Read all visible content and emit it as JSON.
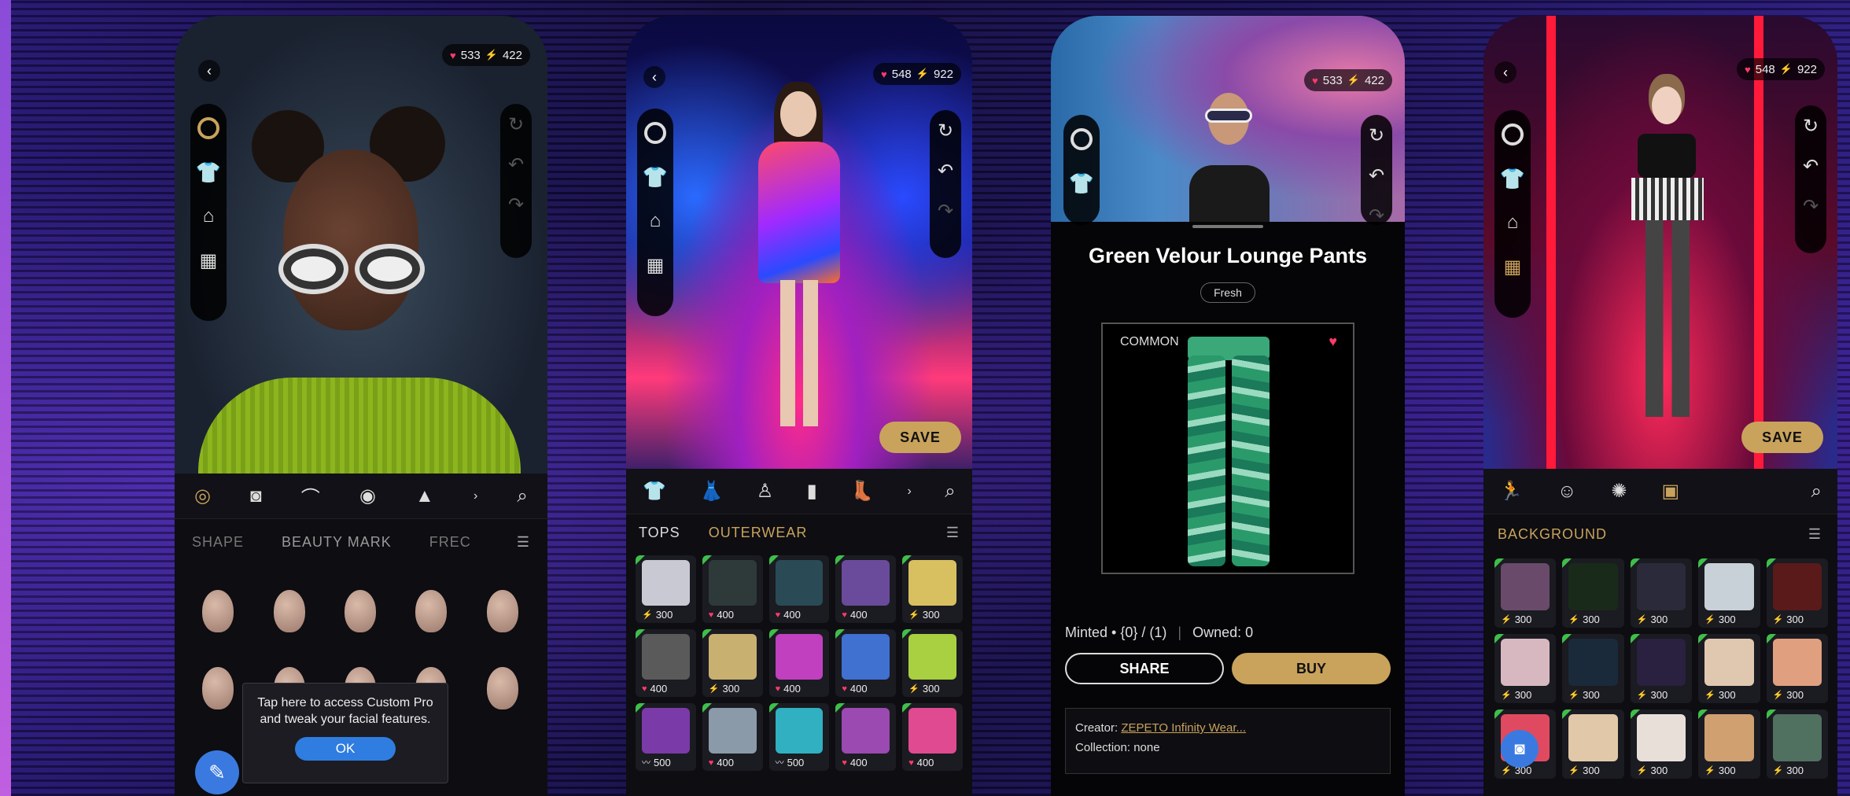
{
  "screens": [
    {
      "stats": {
        "hearts": "533",
        "coins": "422"
      },
      "categories": [
        "face",
        "makeup",
        "eyebrow",
        "eye",
        "nose",
        "more",
        "search"
      ],
      "subtabs": [
        "SHAPE",
        "BEAUTY MARK",
        "FREC"
      ],
      "tooltip": {
        "text": "Tap here to access Custom Pro and tweak your facial features.",
        "ok": "OK"
      }
    },
    {
      "stats": {
        "hearts": "548",
        "coins": "922"
      },
      "save": "SAVE",
      "subtabs": [
        "TOPS",
        "OUTERWEAR"
      ],
      "items": [
        {
          "price": "300",
          "cur": "coin",
          "color": "#c9c9d4"
        },
        {
          "price": "400",
          "cur": "heart",
          "color": "#2e3a3a"
        },
        {
          "price": "400",
          "cur": "heart",
          "color": "#2a4a55"
        },
        {
          "price": "400",
          "cur": "heart",
          "color": "#6a4a9a"
        },
        {
          "price": "300",
          "cur": "coin",
          "color": "#d8c060"
        },
        {
          "price": "400",
          "cur": "heart",
          "color": "#5a5a5a"
        },
        {
          "price": "300",
          "cur": "coin",
          "color": "#c8b070"
        },
        {
          "price": "400",
          "cur": "heart",
          "color": "#c040c0"
        },
        {
          "price": "400",
          "cur": "heart",
          "color": "#4070d0"
        },
        {
          "price": "300",
          "cur": "coin",
          "color": "#a8d040"
        },
        {
          "price": "500",
          "cur": "wing",
          "color": "#7a3aa8"
        },
        {
          "price": "400",
          "cur": "heart",
          "color": "#8a9aa8"
        },
        {
          "price": "500",
          "cur": "wing",
          "color": "#30b0c0"
        },
        {
          "price": "400",
          "cur": "heart",
          "color": "#9a4ab0"
        },
        {
          "price": "400",
          "cur": "heart",
          "color": "#e04a90"
        }
      ]
    },
    {
      "stats": {
        "hearts": "533",
        "coins": "422"
      },
      "product": {
        "name": "Green Velour Lounge Pants",
        "badge": "Fresh",
        "rarity": "COMMON",
        "minted": "Minted • {0} / (1)",
        "owned": "Owned: 0",
        "share": "SHARE",
        "buy": "BUY",
        "creator_label": "Creator:",
        "creator": "ZEPETO Infinity Wear...",
        "collection": "Collection: none"
      }
    },
    {
      "stats": {
        "hearts": "548",
        "coins": "922"
      },
      "save": "SAVE",
      "section": "BACKGROUND",
      "items": [
        {
          "price": "300",
          "color": "#6a4a6a"
        },
        {
          "price": "300",
          "color": "#1a2a1a"
        },
        {
          "price": "300",
          "color": "#2a2a3a"
        },
        {
          "price": "300",
          "color": "#c8d0d8"
        },
        {
          "price": "300",
          "color": "#5a1a1a"
        },
        {
          "price": "300",
          "color": "#d8b8c0"
        },
        {
          "price": "300",
          "color": "#1a2a3a"
        },
        {
          "price": "300",
          "color": "#2a2040"
        },
        {
          "price": "300",
          "color": "#e0c8b0"
        },
        {
          "price": "300",
          "color": "#e0a080"
        },
        {
          "price": "300",
          "color": "#e04a60"
        },
        {
          "price": "300",
          "color": "#e0c8a8"
        },
        {
          "price": "300",
          "color": "#e8e0d8"
        },
        {
          "price": "300",
          "color": "#d0a070"
        },
        {
          "price": "300",
          "color": "#507060"
        }
      ]
    }
  ]
}
